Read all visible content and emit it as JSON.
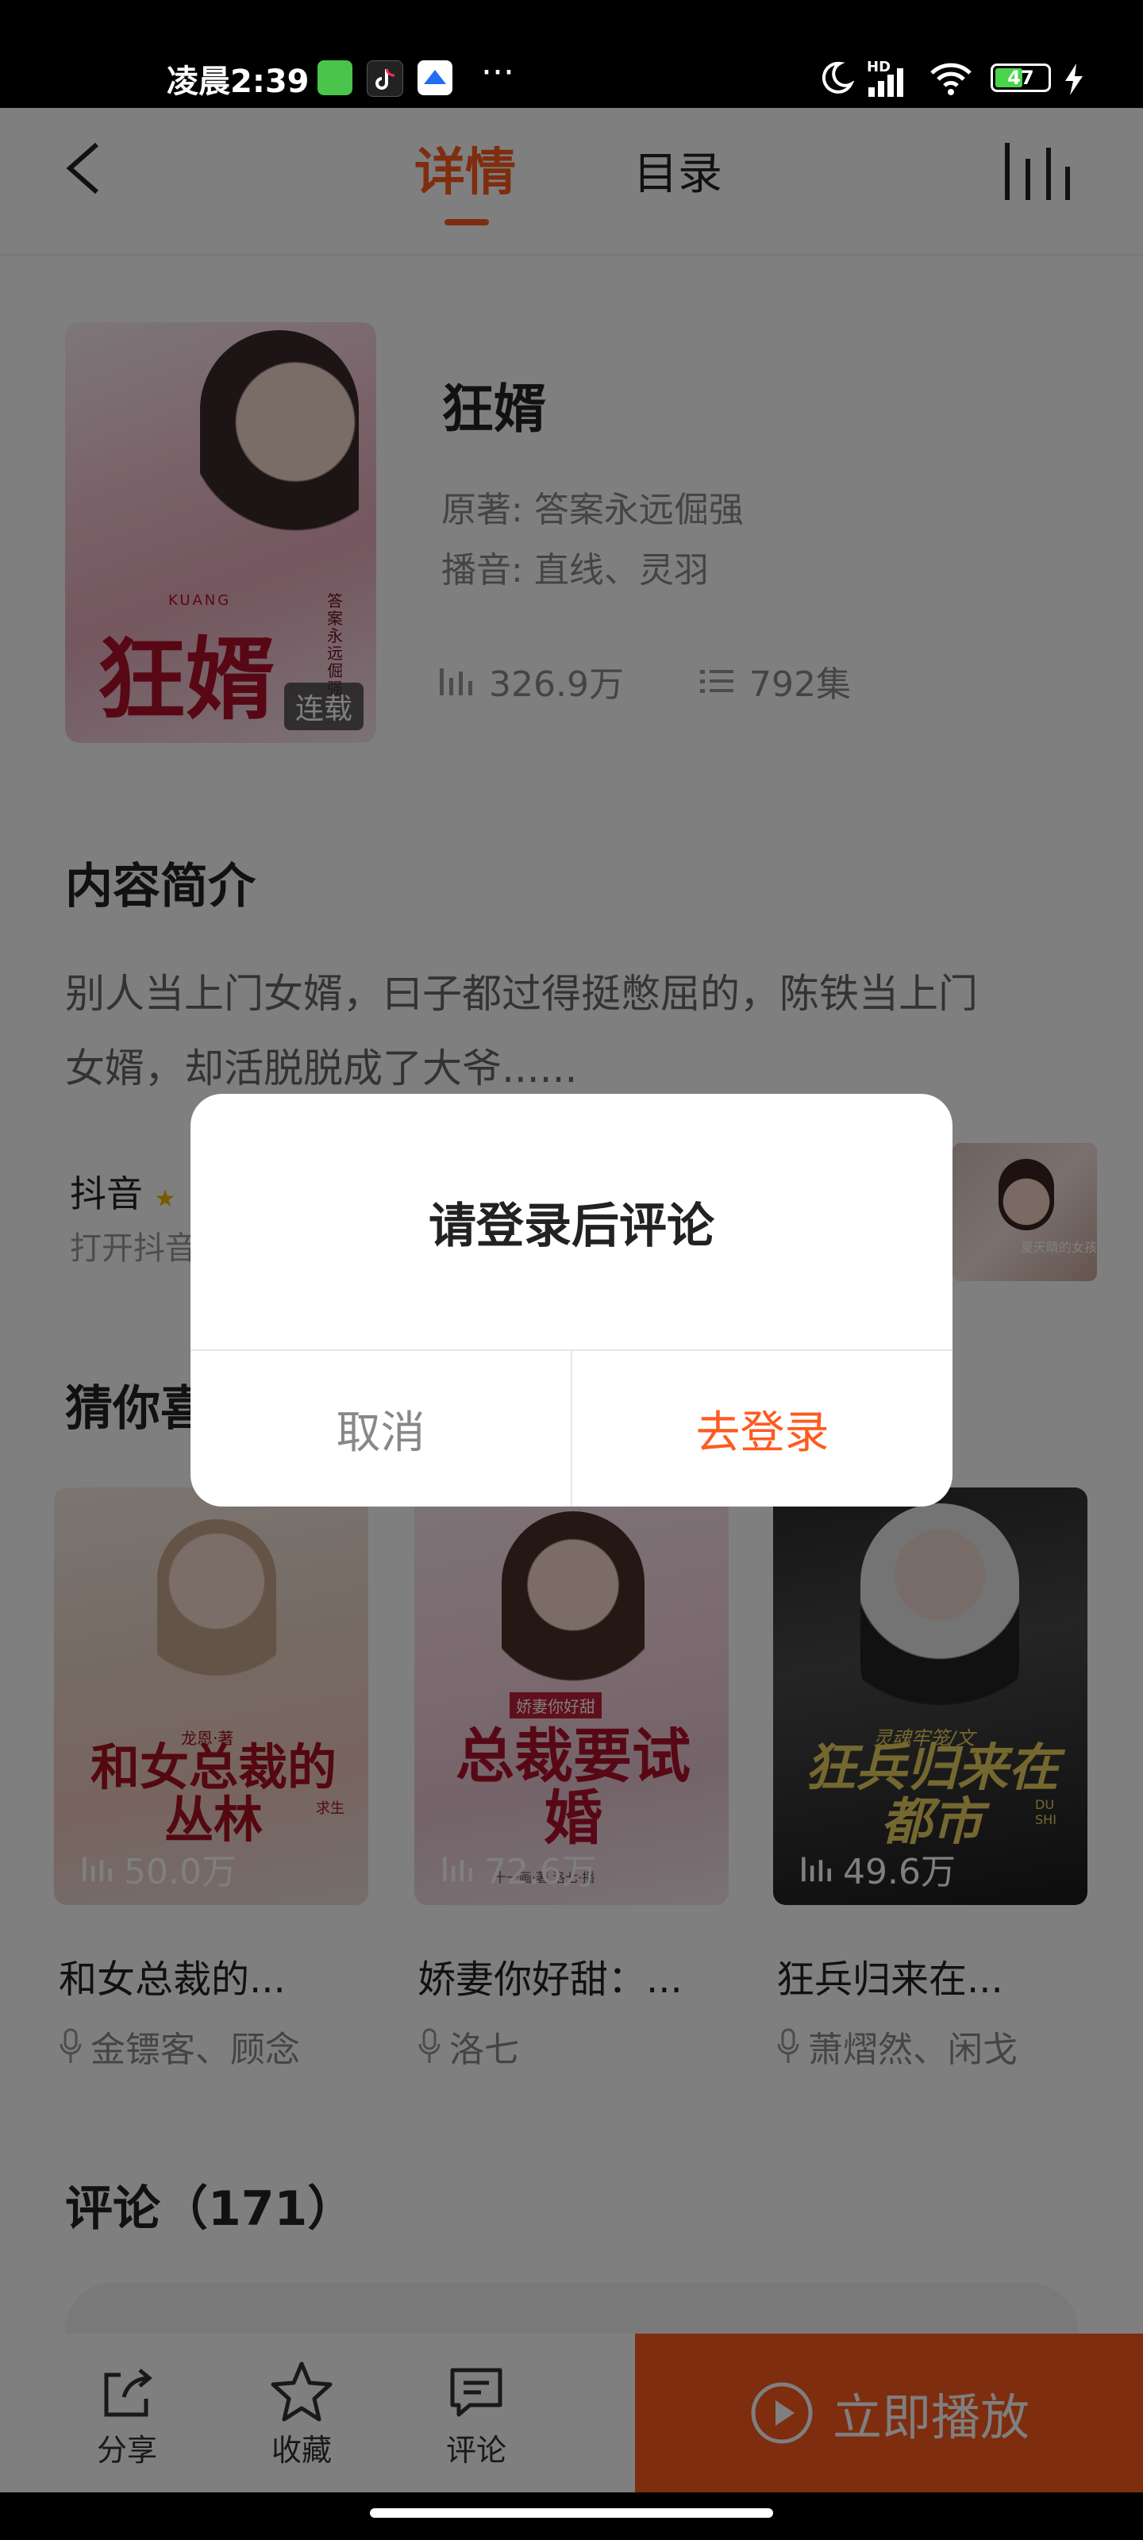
{
  "status_bar": {
    "time": "凌晨2:39",
    "more": "···",
    "network": "HD",
    "battery": "47"
  },
  "header": {
    "tabs": [
      "详情",
      "目录"
    ],
    "active_tab": "详情"
  },
  "book": {
    "title": "狂婿",
    "author_label": "原著:",
    "author": "答案永远倔强",
    "narrator_label": "播音:",
    "narrator": "直线、灵羽",
    "plays": "326.9万",
    "episodes": "792集",
    "status_badge": "连载",
    "cover_title": "狂婿",
    "cover_pinyin": "KUANG",
    "cover_author": "答案永远倔强"
  },
  "intro": {
    "heading": "内容简介",
    "text_line1": "别人当上门女婿，曰子都过得挺憋屈的，陈铁当上门",
    "text_line2": "女婿，却活脱脱成了大爷......"
  },
  "douyin": {
    "label": "抖音",
    "subtext": "打开抖音",
    "thumb_caption": "夏天睛的女孩"
  },
  "recommend": {
    "heading": "猜你喜欢",
    "items": [
      {
        "title": "和女总裁的...",
        "anchors": "金镖客、顾念",
        "plays": "50.0万",
        "cover_text": "和女总裁的丛林",
        "cover_sub": "龙恩·著",
        "cover_tag": "求生"
      },
      {
        "title": "娇妻你好甜：...",
        "anchors": "洛七",
        "plays": "72.6万",
        "cover_text": "总裁要试婚",
        "cover_sub": "娇妻你好甜",
        "cover_tag": "十一画·著 洛七·播"
      },
      {
        "title": "狂兵归来在...",
        "anchors": "萧熠然、闲戈",
        "plays": "49.6万",
        "cover_text": "狂兵归来在都市",
        "cover_sub": "灵魂牢笼/文",
        "cover_tag": "DU SHI"
      }
    ]
  },
  "comments": {
    "heading": "评论",
    "count": "（171）"
  },
  "bottom_bar": {
    "share": "分享",
    "favorite": "收藏",
    "comment": "评论",
    "play_button": "立即播放"
  },
  "dialog": {
    "message": "请登录后评论",
    "cancel": "取消",
    "confirm": "去登录"
  },
  "colors": {
    "accent": "#ff5a1f",
    "play_button": "#ff5a1f",
    "overlay": "rgba(0,0,0,0.5)",
    "touch_indicator": "#1a82f5"
  }
}
